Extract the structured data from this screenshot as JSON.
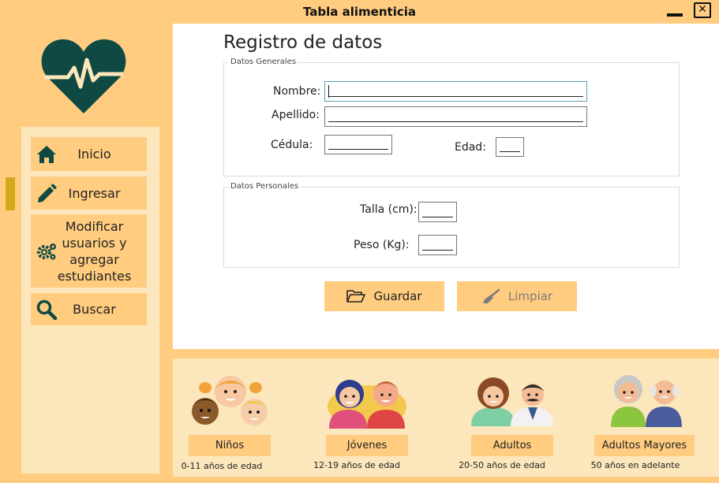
{
  "window": {
    "title": "Tabla alimenticia",
    "minimize_glyph": "",
    "close_glyph": "✕"
  },
  "sidebar": {
    "items": [
      {
        "label": "Inicio",
        "icon": "home-icon"
      },
      {
        "label": "Ingresar",
        "icon": "pencil-icon"
      },
      {
        "label": "Modificar usuarios y agregar estudiantes",
        "icon": "gears-icon"
      },
      {
        "label": "Buscar",
        "icon": "search-icon"
      }
    ],
    "active_index": 1
  },
  "form": {
    "title": "Registro de datos",
    "datos_generales": {
      "legend": "Datos Generales",
      "nombre_label": "Nombre:",
      "apellido_label": "Apellido:",
      "cedula_label": "Cédula:",
      "edad_label": "Edad:",
      "nombre_value": "",
      "apellido_value": "",
      "cedula_value": "",
      "edad_value": ""
    },
    "datos_personales": {
      "legend": "Datos Personales",
      "talla_label": "Talla (cm):",
      "peso_label": "Peso (Kg):",
      "talla_value": "",
      "peso_value": ""
    },
    "buttons": {
      "guardar": "Guardar",
      "limpiar": "Limpiar"
    }
  },
  "categories": [
    {
      "label": "Niños",
      "age": "0-11 años de edad"
    },
    {
      "label": "Jóvenes",
      "age": "12-19 años de edad"
    },
    {
      "label": "Adultos",
      "age": "20-50 años de edad"
    },
    {
      "label": "Adultos Mayores",
      "age": "50 años en adelante"
    }
  ],
  "colors": {
    "accent": "#FFCC80",
    "panel": "#FCE6BC",
    "logo": "#0E4A43",
    "indicator": "#D4A81A"
  }
}
